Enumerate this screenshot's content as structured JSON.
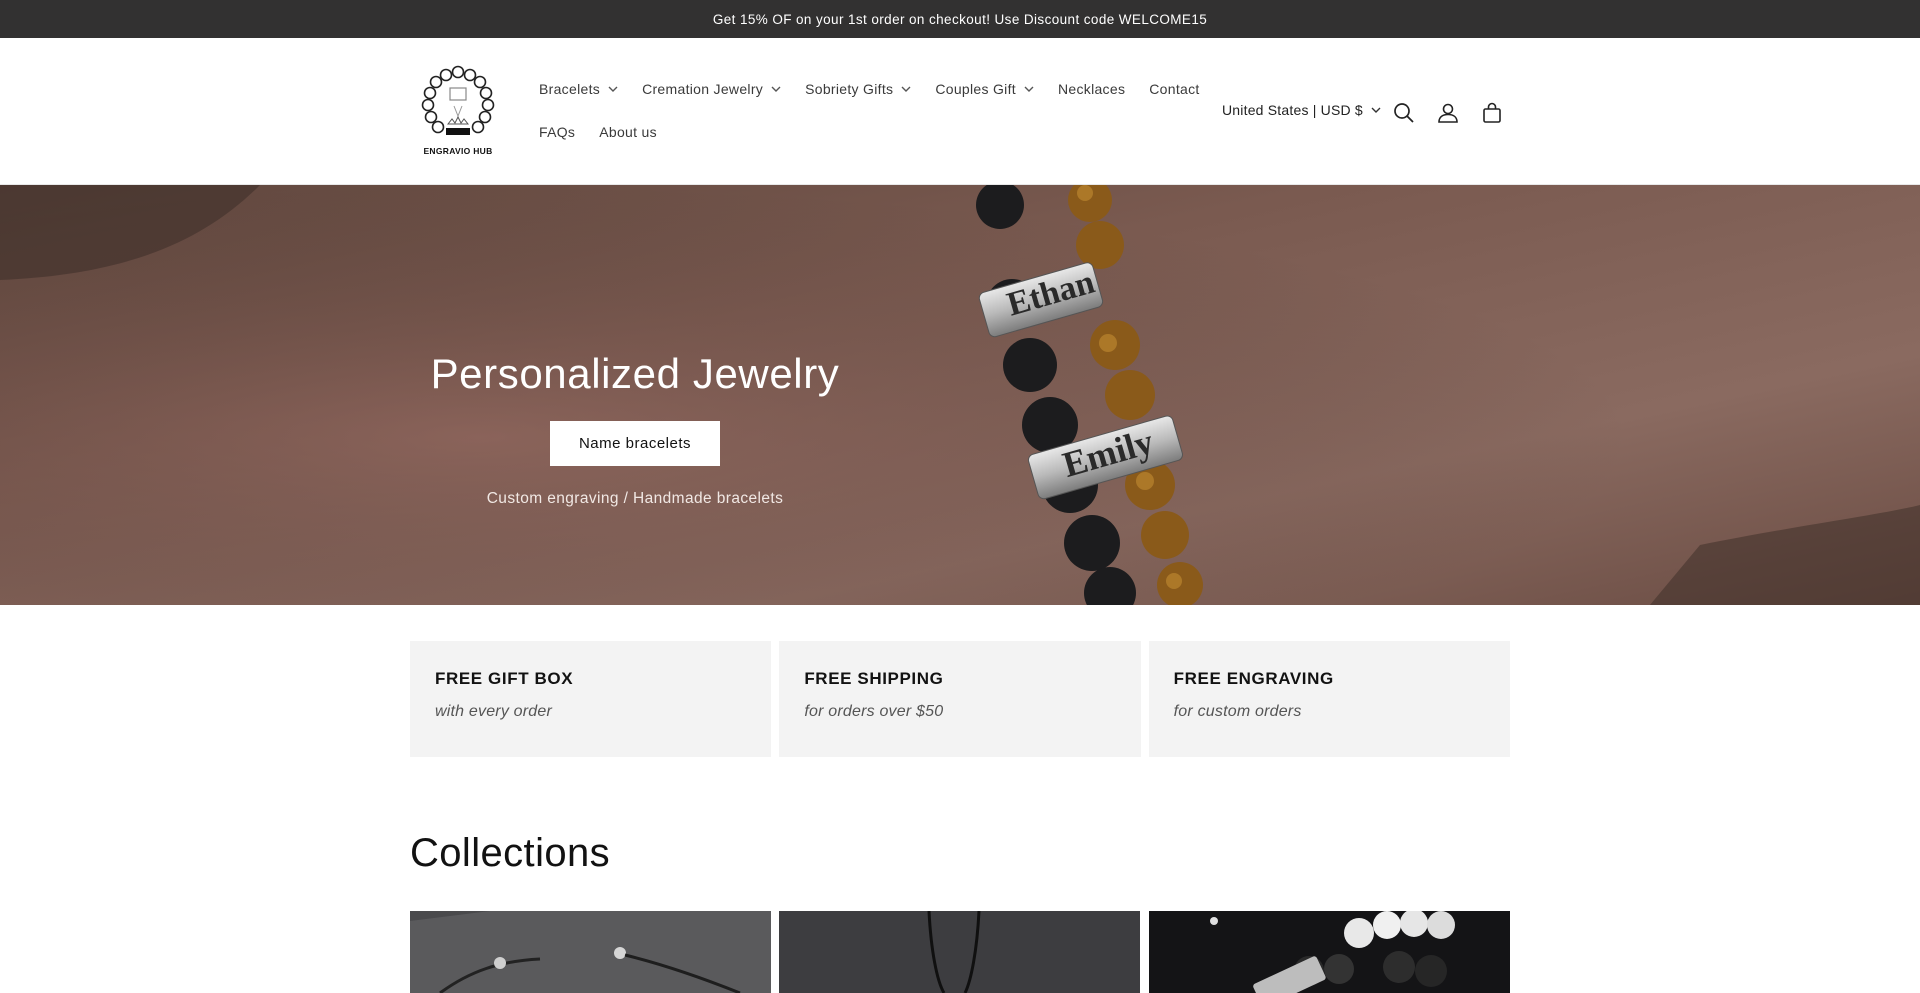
{
  "announcement": {
    "text": "Get 15% OF on your 1st order on checkout! Use Discount code WELCOME15"
  },
  "header": {
    "logo_text": "ENGRAVIO HUB",
    "nav_row1": [
      {
        "label": "Bracelets",
        "dropdown": true
      },
      {
        "label": "Cremation Jewelry",
        "dropdown": true
      },
      {
        "label": "Sobriety Gifts",
        "dropdown": true
      },
      {
        "label": "Couples Gift",
        "dropdown": true
      },
      {
        "label": "Necklaces",
        "dropdown": false
      },
      {
        "label": "Contact",
        "dropdown": false
      }
    ],
    "nav_row2": [
      {
        "label": "FAQs",
        "dropdown": false
      },
      {
        "label": "About us",
        "dropdown": false
      }
    ],
    "country_selector": "United States | USD $",
    "icons": [
      "search-icon",
      "account-icon",
      "cart-icon"
    ]
  },
  "hero": {
    "title": "Personalized Jewelry",
    "button_label": "Name bracelets",
    "subtitle": "Custom engraving / Handmade bracelets",
    "engraving_top": "Ethan",
    "engraving_bottom": "Emily"
  },
  "features": [
    {
      "title": "FREE GIFT BOX",
      "subtitle": "with every order"
    },
    {
      "title": "FREE SHIPPING",
      "subtitle": "for orders over $50"
    },
    {
      "title": "FREE ENGRAVING",
      "subtitle": "for custom orders"
    }
  ],
  "collections": {
    "title": "Collections",
    "tiles": [
      "bracelet-photo",
      "necklace-photo",
      "beaded-bracelet-photo"
    ]
  },
  "colors": {
    "announcement_bg": "#323131",
    "feature_bg": "#f3f3f3",
    "button_bg": "#ffffff"
  }
}
